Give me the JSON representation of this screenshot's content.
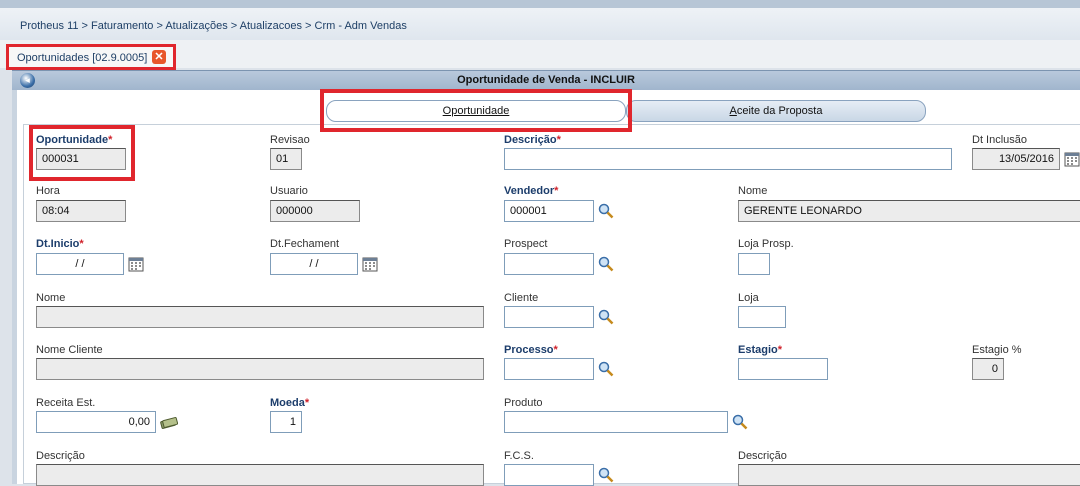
{
  "breadcrumb": "Protheus 11 > Faturamento > Atualizações > Atualizacoes > Crm - Adm Vendas",
  "doc_tab": {
    "label": "Oportunidades [02.9.0005]",
    "close": "✕"
  },
  "window": {
    "title": "Oportunidade de Venda - INCLUIR"
  },
  "tabs": {
    "oportunidade": "Oportunidade",
    "aceite": "Aceite da Proposta"
  },
  "form": {
    "oportunidade": {
      "label": "Oportunidade",
      "value": "000031"
    },
    "revisao": {
      "label": "Revisao",
      "value": "01"
    },
    "descricao": {
      "label": "Descrição",
      "value": ""
    },
    "dt_inclusao": {
      "label": "Dt Inclusão",
      "value": "13/05/2016"
    },
    "hora": {
      "label": "Hora",
      "value": "08:04"
    },
    "usuario": {
      "label": "Usuario",
      "value": "000000"
    },
    "vendedor": {
      "label": "Vendedor",
      "value": "000001"
    },
    "nome_vendedor": {
      "label": "Nome",
      "value": "GERENTE LEONARDO"
    },
    "dt_inicio": {
      "label": "Dt.Inicio",
      "value": "/ /"
    },
    "dt_fechamento": {
      "label": "Dt.Fechament",
      "value": "/ /"
    },
    "prospect": {
      "label": "Prospect",
      "value": ""
    },
    "loja_prosp": {
      "label": "Loja Prosp.",
      "value": ""
    },
    "nome": {
      "label": "Nome",
      "value": ""
    },
    "cliente": {
      "label": "Cliente",
      "value": ""
    },
    "loja": {
      "label": "Loja",
      "value": ""
    },
    "nome_cliente": {
      "label": "Nome Cliente",
      "value": ""
    },
    "processo": {
      "label": "Processo",
      "value": ""
    },
    "estagio": {
      "label": "Estagio",
      "value": ""
    },
    "estagio_pct": {
      "label": "Estagio %",
      "value": "0"
    },
    "receita_est": {
      "label": "Receita Est.",
      "value": "0,00"
    },
    "moeda": {
      "label": "Moeda",
      "value": "1"
    },
    "produto": {
      "label": "Produto",
      "value": ""
    },
    "descricao2": {
      "label": "Descrição",
      "value": ""
    },
    "fcs": {
      "label": "F.C.S.",
      "value": ""
    },
    "descricao3": {
      "label": "Descrição",
      "value": ""
    }
  },
  "required_mark": "*",
  "colors": {
    "required_label": "#1c3d6b",
    "required_star": "#d0212a",
    "highlight": "#e0262d"
  },
  "icons": {
    "search": "magnifier-icon",
    "calendar": "calendar-icon",
    "calculator": "money-icon"
  }
}
